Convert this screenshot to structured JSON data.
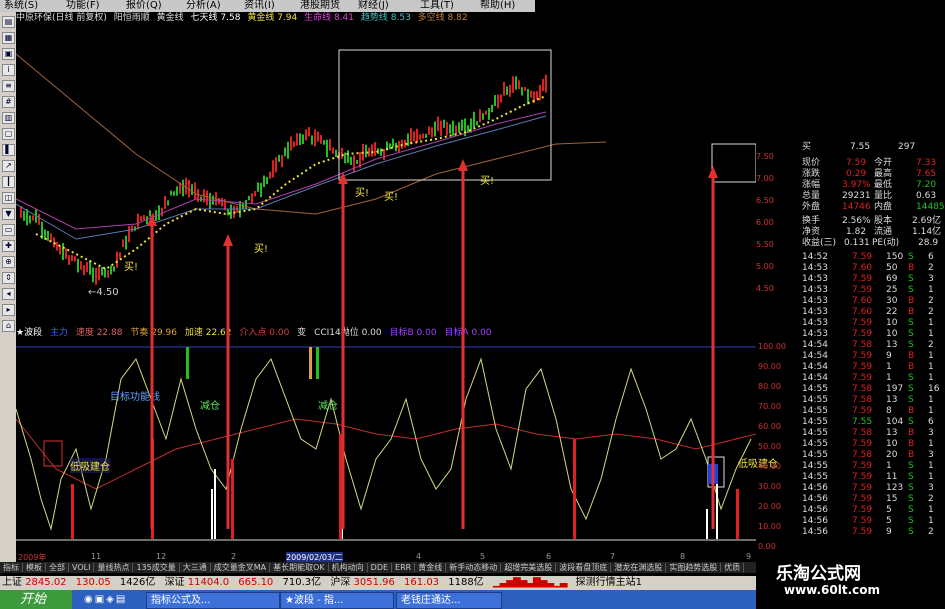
{
  "menu": [
    "系统(S)",
    "功能(F)",
    "报价(Q)",
    "分析(A)",
    "资讯(I)",
    "港股期货",
    "财经(J)",
    "工具(T)",
    "帮助(H)"
  ],
  "title_bar": [
    "中原环保(日线 前复权)",
    "阳恒雨顺",
    "黄金线",
    "七天线 7.58",
    "黄金线 7.94",
    "生命线 8.41",
    "趋势线 8.53",
    "多空线 8.82"
  ],
  "main_chart": {
    "low_label": "←4.50",
    "buy_label": "买!",
    "price_ticks": [
      "7.50",
      "7.00",
      "6.50",
      "6.00",
      "5.50",
      "5.00",
      "4.50"
    ]
  },
  "indicator_title": [
    "★波段",
    "主力",
    "速度 22.88",
    "节奏 29.96",
    "加速 22.62",
    "介入点 0.00",
    "变",
    "CCI14抛位 0.00",
    "目标B 0.00",
    "目标A 0.00"
  ],
  "indicator_annotations": [
    "低吸建仓",
    "目标功能线",
    "减仓",
    "减仓",
    "低吸建仓"
  ],
  "indicator_ticks": [
    "100.00",
    "90.00",
    "80.00",
    "70.00",
    "60.00",
    "50.00",
    "40.00",
    "30.00",
    "20.00",
    "10.00",
    "0.00"
  ],
  "x_axis": [
    "2009年",
    "11",
    "12",
    "2",
    "2009/02/03/二",
    "4",
    "5",
    "6",
    "7",
    "8",
    "9"
  ],
  "bottom_tabs": [
    "指标",
    "模板",
    "全部",
    "VOLI",
    "量线热点",
    "135成交量",
    "大三通",
    "成交量金叉MA",
    "基长期能取OK",
    "机构动向",
    "DDE",
    "ERR",
    "黄金线",
    "新手动态移动",
    "超增完美选股",
    "波段看盘顶底",
    "潜龙在渊选股",
    "实图趋势选股",
    "优质"
  ],
  "status_bar": {
    "sh_label": "上证",
    "sh_index": "2845.02",
    "sh_change": "130.05",
    "sh_amount": "1426亿",
    "sz_label": "深证",
    "sz_index": "11404.0",
    "sz_change": "665.10",
    "sz_amount": "710.3亿",
    "hs_label": "沪深",
    "hs_index": "3051.96",
    "hs_change": "161.03",
    "hs_amount": "1188亿",
    "server": "探测行情主站1"
  },
  "taskbar": {
    "start": "开始",
    "tasks": [
      "指标公式及...",
      "★波段 - 指...",
      "老钱庄通达..."
    ]
  },
  "quote_panel": [
    [
      "买",
      "7.55",
      "297"
    ],
    [
      "现价",
      "7.59",
      "今开",
      "7.33"
    ],
    [
      "涨跌",
      "0.29",
      "最高",
      "7.65"
    ],
    [
      "涨幅",
      "3.97%",
      "最低",
      "7.20"
    ],
    [
      "总量",
      "29231",
      "量比",
      "0.63"
    ],
    [
      "外盘",
      "14746",
      "内盘",
      "14485"
    ],
    [
      "换手",
      "2.56%",
      "股本",
      "2.69亿"
    ],
    [
      "净资",
      "1.82",
      "流通",
      "1.14亿"
    ],
    [
      "收益(三)",
      "0.131",
      "PE(动)",
      "28.9"
    ]
  ],
  "trades": [
    [
      "14:52",
      "7.59",
      "150",
      "S",
      "6"
    ],
    [
      "14:53",
      "7.60",
      "50",
      "B",
      "2"
    ],
    [
      "14:53",
      "7.59",
      "69",
      "S",
      "3"
    ],
    [
      "14:53",
      "7.59",
      "25",
      "S",
      "1"
    ],
    [
      "14:53",
      "7.60",
      "30",
      "B",
      "2"
    ],
    [
      "14:53",
      "7.60",
      "22",
      "B",
      "2"
    ],
    [
      "14:53",
      "7.59",
      "10",
      "S",
      "1"
    ],
    [
      "14:53",
      "7.59",
      "10",
      "S",
      "1"
    ],
    [
      "14:54",
      "7.58",
      "13",
      "S",
      "2"
    ],
    [
      "14:54",
      "7.59",
      "9",
      "B",
      "1"
    ],
    [
      "14:54",
      "7.59",
      "1",
      "B",
      "1"
    ],
    [
      "14:54",
      "7.59",
      "1",
      "S",
      "1"
    ],
    [
      "14:55",
      "7.58",
      "197",
      "S",
      "16"
    ],
    [
      "14:55",
      "7.58",
      "13",
      "S",
      "1"
    ],
    [
      "14:55",
      "7.59",
      "8",
      "B",
      "1"
    ],
    [
      "14:55",
      "7.55",
      "104",
      "S",
      "6"
    ],
    [
      "14:55",
      "7.58",
      "13",
      "B",
      "3"
    ],
    [
      "14:55",
      "7.59",
      "10",
      "B",
      "1"
    ],
    [
      "14:55",
      "7.58",
      "20",
      "B",
      "3"
    ],
    [
      "14:55",
      "7.59",
      "1",
      "S",
      "1"
    ],
    [
      "14:55",
      "7.59",
      "11",
      "S",
      "1"
    ],
    [
      "14:56",
      "7.59",
      "123",
      "S",
      "3"
    ],
    [
      "14:56",
      "7.59",
      "15",
      "S",
      "2"
    ],
    [
      "14:56",
      "7.59",
      "5",
      "S",
      "1"
    ],
    [
      "14:56",
      "7.59",
      "5",
      "S",
      "1"
    ],
    [
      "14:56",
      "7.59",
      "9",
      "S",
      "2"
    ]
  ],
  "watermark": {
    "title": "乐淘公式网",
    "url": "www.60lt.com"
  },
  "colors": {
    "up": "#e02020",
    "down": "#20c020",
    "gold": "#f0e040",
    "orange": "#e0a040",
    "blue": "#4040e0"
  }
}
